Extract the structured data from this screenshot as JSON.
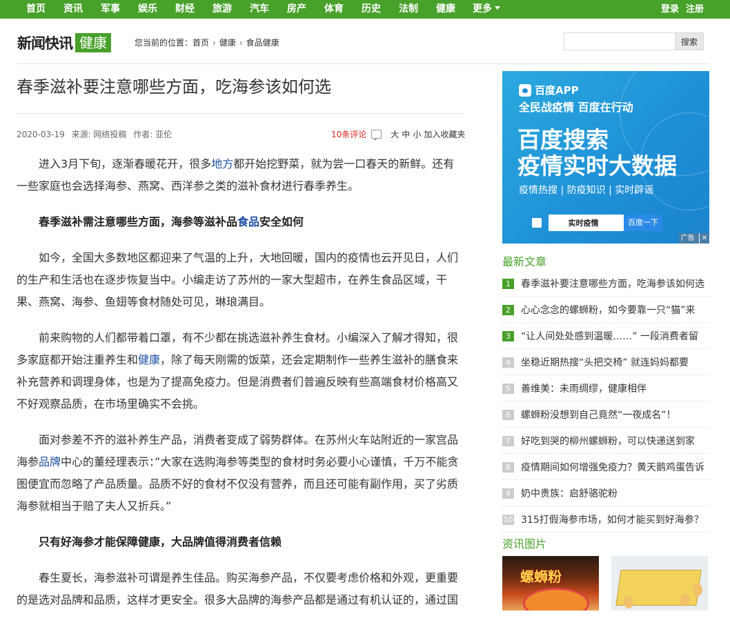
{
  "nav": {
    "items": [
      "首页",
      "资讯",
      "军事",
      "娱乐",
      "财经",
      "旅游",
      "汽车",
      "房产",
      "体育",
      "历史",
      "法制",
      "健康"
    ],
    "more": "更多",
    "login": "登录",
    "register": "注册"
  },
  "header": {
    "logo_text": "新闻快讯",
    "logo_tag": "健康",
    "breadcrumb_label": "您当前的位置：",
    "breadcrumb": [
      "首页",
      "健康",
      "食品健康"
    ],
    "search_placeholder": "",
    "search_button": "搜索"
  },
  "article": {
    "title": "春季滋补要注意哪些方面，吃海参该如何选",
    "date": "2020-03-19",
    "source": "来源: 网络投稿",
    "author": "作者: 亚伦",
    "comments": "10条评论",
    "size_big": "大",
    "size_mid": "中",
    "size_small": "小",
    "favorite": "加入收藏夹",
    "p1a": "进入3月下旬，逐渐春暖花开，很多",
    "p1link": "地方",
    "p1b": "都开始挖野菜，就为尝一口春天的新鲜。还有一些家庭也会选择海参、燕窝、西洋参之类的滋补食材进行春季养生。",
    "h1a": "春季滋补需注意哪些方面，海参等滋补品",
    "h1link": "食品",
    "h1b": "安全如何",
    "p2": "如今，全国大多数地区都迎来了气温的上升，大地回暖，国内的疫情也云开见日，人们的生产和生活也在逐步恢复当中。小编走访了苏州的一家大型超市，在养生食品区域，干果、燕窝、海参、鱼翅等食材随处可见，琳琅满目。",
    "p3a": "前来购物的人们都带着口罩，有不少都在挑选滋补养生食材。小编深入了解才得知，很多家庭都开始注重养生和",
    "p3link": "健康",
    "p3b": "，除了每天刚需的饭菜，还会定期制作一些养生滋补的膳食来补充营养和调理身体，也是为了提高免疫力。但是消费者们普遍反映有些高端食材价格高又不好观察品质，在市场里确实不会挑。",
    "p4a": "面对参差不齐的滋补养生产品，消费者变成了弱势群体。在苏州火车站附近的一家宫品海参",
    "p4link": "品牌",
    "p4b": "中心的董经理表示：”大家在选购海参等类型的食材时务必要小心谨慎，千万不能贪图便宜而忽略了产品质量。品质不好的食材不仅没有营养，而且还可能有副作用，买了劣质海参就相当于赔了夫人又折兵。”",
    "h2": "只有好海参才能保障健康，大品牌值得消费者信赖",
    "p5": "春生夏长，海参滋补可谓是养生佳品。购买海参产品，不仅要考虑价格和外观，更重要的是选对品牌和品质，这样才更安全。很多大品牌的海参产品都是通过有机认证的，通过国"
  },
  "ad": {
    "brand": "百度APP",
    "line1": "全民战疫情 百度在行动",
    "line2": "百度搜索",
    "line3": "疫情实时大数据",
    "line4": "疫情热搜 | 防疫知识 | 实时辟谣",
    "search_text": "实时疫情",
    "search_button": "百度一下",
    "ad_label": "广告",
    "close": "✕"
  },
  "sidebar": {
    "latest_title": "最新文章",
    "latest": [
      {
        "num": "1",
        "title": "春季滋补要注意哪些方面，吃海参该如何选"
      },
      {
        "num": "2",
        "title": "心心念念的螺蛳粉，如今要靠一只“猫”来"
      },
      {
        "num": "3",
        "title": "“让人间处处感到温暖……” 一段消费者留"
      },
      {
        "num": "4",
        "title": "坐稳近期热搜“头把交椅”  就连妈妈都要"
      },
      {
        "num": "5",
        "title": "善维美：未雨绸缪，健康相伴"
      },
      {
        "num": "6",
        "title": "螺蛳粉没想到自己竟然“一夜成名”！"
      },
      {
        "num": "7",
        "title": "好吃到哭的柳州螺蛳粉，可以快递送到家"
      },
      {
        "num": "8",
        "title": "疫情期间如何增强免疫力？黄天鹅鸡蛋告诉"
      },
      {
        "num": "9",
        "title": "奶中贵族：启舒骆驼粉"
      },
      {
        "num": "10",
        "title": "315打假海参市场，如何才能买到好海参？"
      }
    ],
    "pics_title": "资讯图片",
    "pic1_text": "螺蛳粉"
  },
  "colors": {
    "brand_green": "#48a12a",
    "link_blue": "#1e50a2",
    "comment_red": "#d9241b"
  }
}
